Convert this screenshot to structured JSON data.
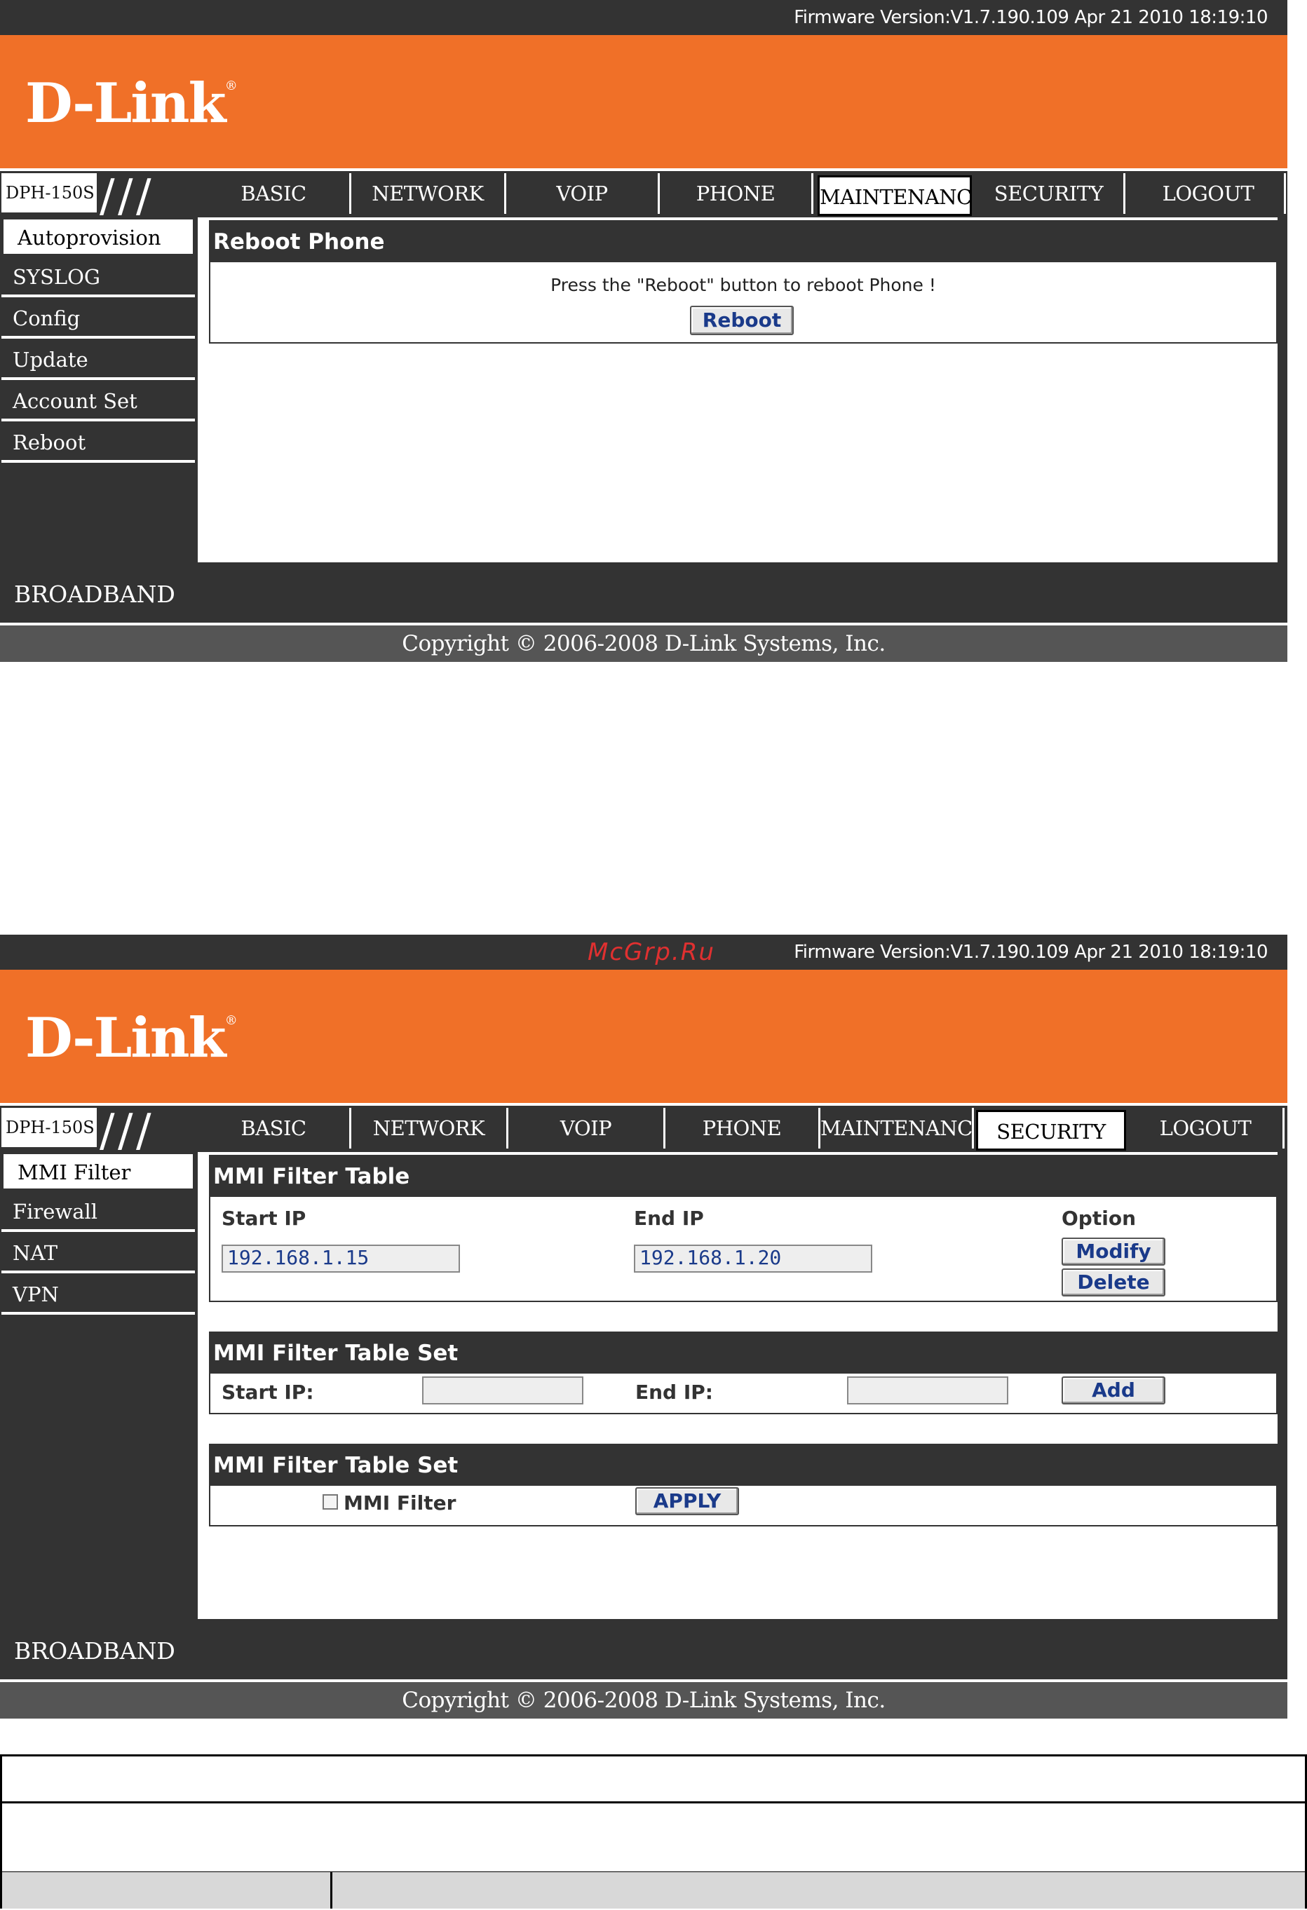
{
  "firmware": "Firmware Version:V1.7.190.109 Apr 21 2010 18:19:10",
  "brand": {
    "name": "D-Link",
    "mark": "®"
  },
  "model": "DPH-150S",
  "tabs": [
    "BASIC",
    "NETWORK",
    "VOIP",
    "PHONE",
    "MAINTENANCE",
    "SECURITY",
    "LOGOUT"
  ],
  "screen1": {
    "active_tab": "MAINTENANCE",
    "sidebar": [
      "Autoprovision",
      "SYSLOG",
      "Config",
      "Update",
      "Account Set",
      "Reboot"
    ],
    "panel_title": "Reboot Phone",
    "message": "Press the \"Reboot\" button to reboot Phone !",
    "reboot_button": "Reboot"
  },
  "screen2": {
    "active_tab": "SECURITY",
    "sidebar": [
      "MMI Filter",
      "Firewall",
      "NAT",
      "VPN"
    ],
    "filter_table": {
      "title": "MMI Filter Table",
      "col_start": "Start IP",
      "col_end": "End IP",
      "col_option": "Option",
      "start_ip": "192.168.1.15",
      "end_ip": "192.168.1.20",
      "modify": "Modify",
      "delete": "Delete"
    },
    "filter_set": {
      "title": "MMI Filter Table Set",
      "start_label": "Start IP:",
      "end_label": "End IP:",
      "start_value": "",
      "end_value": "",
      "add": "Add"
    },
    "filter_enable": {
      "title": "MMI Filter Table Set",
      "checkbox_label": "MMI Filter",
      "checked": false,
      "apply": "APPLY"
    }
  },
  "footer": {
    "broadband": "BROADBAND",
    "copyright": "Copyright © 2006-2008 D-Link Systems, Inc."
  },
  "watermark": "McGrp.Ru",
  "colors": {
    "brand_orange": "#f07028",
    "dark": "#333333",
    "button_text": "#1a3a8a",
    "watermark": "#e03030"
  }
}
